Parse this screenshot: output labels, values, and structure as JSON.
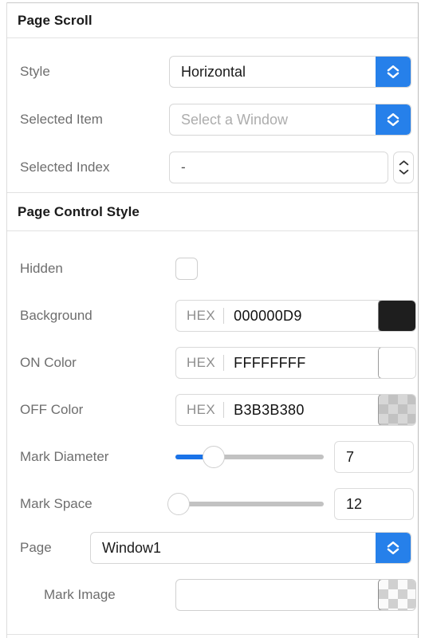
{
  "theme": {
    "accent_blue": "#2680EA",
    "slider_blue": "#1A73E8",
    "label_gray": "#6E6E6E",
    "placeholder_gray": "#ADADAD",
    "border_gray": "#D9D9D9",
    "background": "#FFFFFF"
  },
  "sections": [
    {
      "title": "Page Scroll",
      "rows": [
        {
          "label": "Style",
          "control": "dropdown",
          "value": "Horizontal"
        },
        {
          "label": "Selected Item",
          "control": "dropdown",
          "value": "",
          "placeholder": "Select a Window"
        },
        {
          "label": "Selected Index",
          "control": "stepper-field",
          "value": "-"
        }
      ]
    },
    {
      "title": "Page Control Style",
      "rows": [
        {
          "label": "Hidden",
          "control": "checkbox",
          "checked": false
        },
        {
          "label": "Background",
          "control": "hex",
          "tag": "HEX",
          "value": "000000D9",
          "swatch": "#1E1E1E"
        },
        {
          "label": "ON Color",
          "control": "hex",
          "tag": "HEX",
          "value": "FFFFFFFF",
          "swatch": "#FFFFFF"
        },
        {
          "label": "OFF Color",
          "control": "hex",
          "tag": "HEX",
          "value": "B3B3B380",
          "swatch": "rgba(179,179,179,0.5)"
        },
        {
          "label": "Mark Diameter",
          "control": "slider",
          "value": "7",
          "fill_pct": 26
        },
        {
          "label": "Mark Space",
          "control": "slider",
          "value": "12",
          "fill_pct": 2
        },
        {
          "label": "Page",
          "control": "dropdown",
          "value": "Window1"
        },
        {
          "label": "Mark Image",
          "control": "imagewell",
          "value": ""
        }
      ]
    }
  ],
  "icons": {
    "chevron_up_down": "chevron-up-down-icon",
    "stepper_up": "chevron-up-icon",
    "stepper_down": "chevron-down-icon"
  }
}
